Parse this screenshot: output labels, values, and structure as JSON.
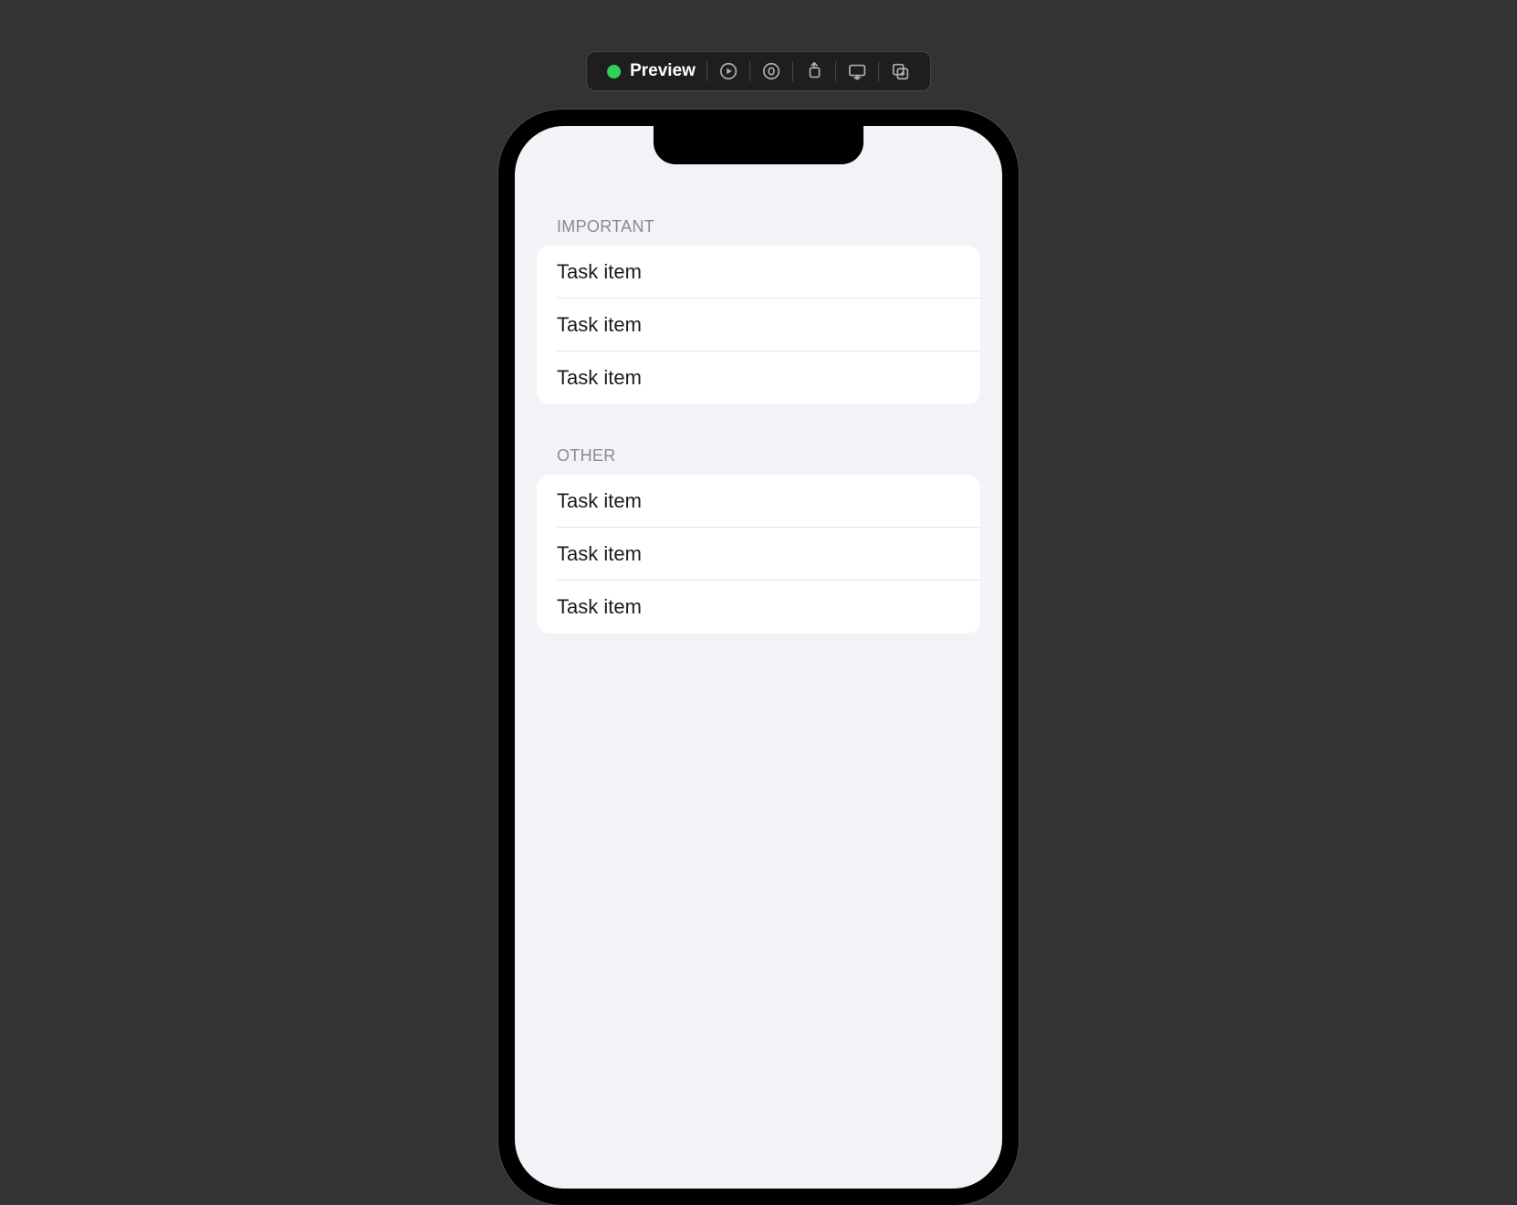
{
  "toolbar": {
    "status_color": "#30d158",
    "label": "Preview"
  },
  "sections": [
    {
      "header": "IMPORTANT",
      "items": [
        "Task item",
        "Task item",
        "Task item"
      ]
    },
    {
      "header": "OTHER",
      "items": [
        "Task item",
        "Task item",
        "Task item"
      ]
    }
  ]
}
